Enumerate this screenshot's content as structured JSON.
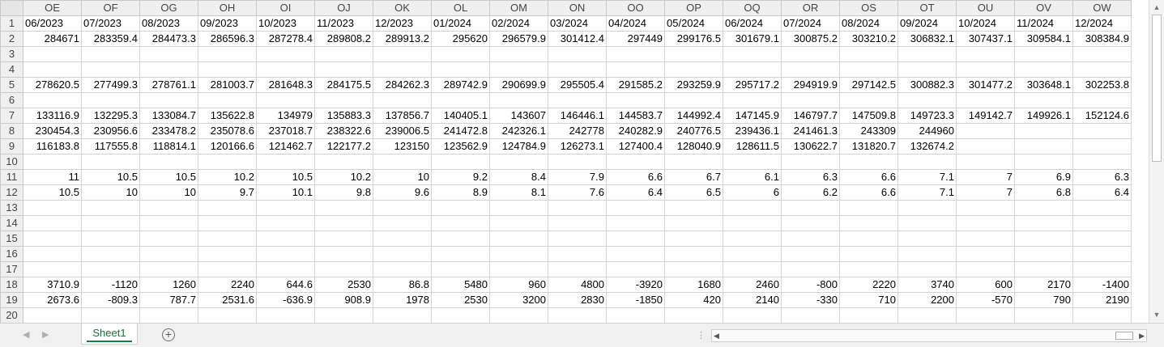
{
  "columns": [
    "OE",
    "OF",
    "OG",
    "OH",
    "OI",
    "OJ",
    "OK",
    "OL",
    "OM",
    "ON",
    "OO",
    "OP",
    "OQ",
    "OR",
    "OS",
    "OT",
    "OU",
    "OV",
    "OW"
  ],
  "rows": [
    {
      "n": "1",
      "text": true,
      "cells": [
        "06/2023",
        "07/2023",
        "08/2023",
        "09/2023",
        "10/2023",
        "11/2023",
        "12/2023",
        "01/2024",
        "02/2024",
        "03/2024",
        "04/2024",
        "05/2024",
        "06/2024",
        "07/2024",
        "08/2024",
        "09/2024",
        "10/2024",
        "11/2024",
        "12/2024"
      ]
    },
    {
      "n": "2",
      "cells": [
        "284671",
        "283359.4",
        "284473.3",
        "286596.3",
        "287278.4",
        "289808.2",
        "289913.2",
        "295620",
        "296579.9",
        "301412.4",
        "297449",
        "299176.5",
        "301679.1",
        "300875.2",
        "303210.2",
        "306832.1",
        "307437.1",
        "309584.1",
        "308384.9"
      ]
    },
    {
      "n": "3",
      "cells": [
        "",
        "",
        "",
        "",
        "",
        "",
        "",
        "",
        "",
        "",
        "",
        "",
        "",
        "",
        "",
        "",
        "",
        "",
        ""
      ]
    },
    {
      "n": "4",
      "cells": [
        "",
        "",
        "",
        "",
        "",
        "",
        "",
        "",
        "",
        "",
        "",
        "",
        "",
        "",
        "",
        "",
        "",
        "",
        ""
      ]
    },
    {
      "n": "5",
      "cells": [
        "278620.5",
        "277499.3",
        "278761.1",
        "281003.7",
        "281648.3",
        "284175.5",
        "284262.3",
        "289742.9",
        "290699.9",
        "295505.4",
        "291585.2",
        "293259.9",
        "295717.2",
        "294919.9",
        "297142.5",
        "300882.3",
        "301477.2",
        "303648.1",
        "302253.8"
      ]
    },
    {
      "n": "6",
      "cells": [
        "",
        "",
        "",
        "",
        "",
        "",
        "",
        "",
        "",
        "",
        "",
        "",
        "",
        "",
        "",
        "",
        "",
        "",
        ""
      ]
    },
    {
      "n": "7",
      "cells": [
        "133116.9",
        "132295.3",
        "133084.7",
        "135622.8",
        "134979",
        "135883.3",
        "137856.7",
        "140405.1",
        "143607",
        "146446.1",
        "144583.7",
        "144992.4",
        "147145.9",
        "146797.7",
        "147509.8",
        "149723.3",
        "149142.7",
        "149926.1",
        "152124.6"
      ]
    },
    {
      "n": "8",
      "cells": [
        "230454.3",
        "230956.6",
        "233478.2",
        "235078.6",
        "237018.7",
        "238322.6",
        "239006.5",
        "241472.8",
        "242326.1",
        "242778",
        "240282.9",
        "240776.5",
        "239436.1",
        "241461.3",
        "243309",
        "244960",
        "",
        "",
        ""
      ]
    },
    {
      "n": "9",
      "cells": [
        "116183.8",
        "117555.8",
        "118814.1",
        "120166.6",
        "121462.7",
        "122177.2",
        "123150",
        "123562.9",
        "124784.9",
        "126273.1",
        "127400.4",
        "128040.9",
        "128611.5",
        "130622.7",
        "131820.7",
        "132674.2",
        "",
        "",
        ""
      ]
    },
    {
      "n": "10",
      "cells": [
        "",
        "",
        "",
        "",
        "",
        "",
        "",
        "",
        "",
        "",
        "",
        "",
        "",
        "",
        "",
        "",
        "",
        "",
        ""
      ]
    },
    {
      "n": "11",
      "cells": [
        "11",
        "10.5",
        "10.5",
        "10.2",
        "10.5",
        "10.2",
        "10",
        "9.2",
        "8.4",
        "7.9",
        "6.6",
        "6.7",
        "6.1",
        "6.3",
        "6.6",
        "7.1",
        "7",
        "6.9",
        "6.3"
      ]
    },
    {
      "n": "12",
      "cells": [
        "10.5",
        "10",
        "10",
        "9.7",
        "10.1",
        "9.8",
        "9.6",
        "8.9",
        "8.1",
        "7.6",
        "6.4",
        "6.5",
        "6",
        "6.2",
        "6.6",
        "7.1",
        "7",
        "6.8",
        "6.4"
      ]
    },
    {
      "n": "13",
      "cells": [
        "",
        "",
        "",
        "",
        "",
        "",
        "",
        "",
        "",
        "",
        "",
        "",
        "",
        "",
        "",
        "",
        "",
        "",
        ""
      ]
    },
    {
      "n": "14",
      "cells": [
        "",
        "",
        "",
        "",
        "",
        "",
        "",
        "",
        "",
        "",
        "",
        "",
        "",
        "",
        "",
        "",
        "",
        "",
        ""
      ]
    },
    {
      "n": "15",
      "cells": [
        "",
        "",
        "",
        "",
        "",
        "",
        "",
        "",
        "",
        "",
        "",
        "",
        "",
        "",
        "",
        "",
        "",
        "",
        ""
      ]
    },
    {
      "n": "16",
      "cells": [
        "",
        "",
        "",
        "",
        "",
        "",
        "",
        "",
        "",
        "",
        "",
        "",
        "",
        "",
        "",
        "",
        "",
        "",
        ""
      ]
    },
    {
      "n": "17",
      "cells": [
        "",
        "",
        "",
        "",
        "",
        "",
        "",
        "",
        "",
        "",
        "",
        "",
        "",
        "",
        "",
        "",
        "",
        "",
        ""
      ]
    },
    {
      "n": "18",
      "cells": [
        "3710.9",
        "-1120",
        "1260",
        "2240",
        "644.6",
        "2530",
        "86.8",
        "5480",
        "960",
        "4800",
        "-3920",
        "1680",
        "2460",
        "-800",
        "2220",
        "3740",
        "600",
        "2170",
        "-1400"
      ]
    },
    {
      "n": "19",
      "cells": [
        "2673.6",
        "-809.3",
        "787.7",
        "2531.6",
        "-636.9",
        "908.9",
        "1978",
        "2530",
        "3200",
        "2830",
        "-1850",
        "420",
        "2140",
        "-330",
        "710",
        "2200",
        "-570",
        "790",
        "2190"
      ]
    },
    {
      "n": "20",
      "cells": [
        "",
        "",
        "",
        "",
        "",
        "",
        "",
        "",
        "",
        "",
        "",
        "",
        "",
        "",
        "",
        "",
        "",
        "",
        ""
      ]
    }
  ],
  "sheet_tab": {
    "label": "Sheet1"
  },
  "add_sheet": {
    "label": "⊕"
  },
  "colors": {
    "tab_text": "#1e6b3a",
    "grid_line": "#d4d4d4",
    "header_bg": "#efefef"
  },
  "icons": {
    "add": "plus-circle-icon",
    "scroll_left": "triangle-left-icon",
    "scroll_right": "triangle-right-icon",
    "scroll_up": "triangle-up-icon",
    "scroll_down": "triangle-down-icon"
  }
}
